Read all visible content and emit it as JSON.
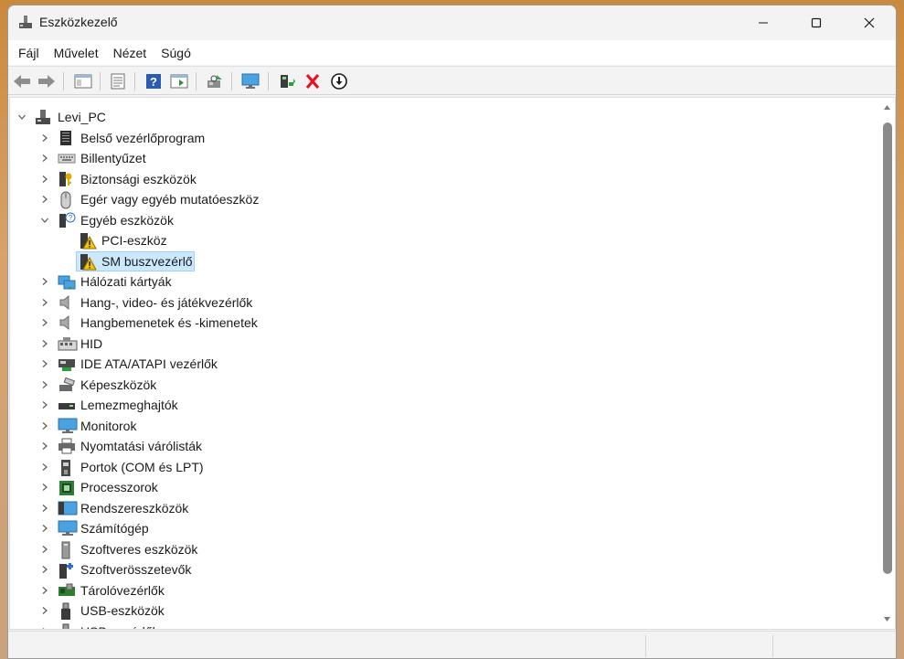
{
  "window": {
    "title": "Eszközkezelő"
  },
  "menu": [
    "Fájl",
    "Művelet",
    "Nézet",
    "Súgó"
  ],
  "toolbar": {
    "buttons": [
      "back-icon",
      "forward-icon",
      "console-tree-icon",
      "properties-icon",
      "help-icon",
      "action-pane-icon",
      "scan-hardware-icon",
      "computer-monitor-icon",
      "update-driver-icon",
      "uninstall-icon",
      "disable-device-icon"
    ]
  },
  "tree": {
    "root": "Levi_PC",
    "categories": [
      "Belső vezérlőprogram",
      "Billentyűzet",
      "Biztonsági eszközök",
      "Egér vagy egyéb mutatóeszköz",
      "Egyéb eszközök",
      "Hálózati kártyák",
      "Hang-, video- és játékvezérlők",
      "Hangbemenetek és -kimenetek",
      "HID",
      "IDE ATA/ATAPI vezérlők",
      "Képeszközök",
      "Lemezmeghajtók",
      "Monitorok",
      "Nyomtatási várólisták",
      "Portok (COM és LPT)",
      "Processzorok",
      "Rendszereszközök",
      "Számítógép",
      "Szoftveres eszközök",
      "Szoftverösszetevők",
      "Tárolóvezérlők",
      "USB-eszközök",
      "USB-vezérlők"
    ],
    "expanded_category": "Egyéb eszközök",
    "children": [
      "PCI-eszköz",
      "SM buszvezérlő"
    ],
    "selected": "SM buszvezérlő"
  },
  "colors": {
    "selection": "#cce8ff",
    "selection_border": "#99d1ff",
    "uninstall_red": "#e81123",
    "warning_yellow": "#f5c400"
  }
}
